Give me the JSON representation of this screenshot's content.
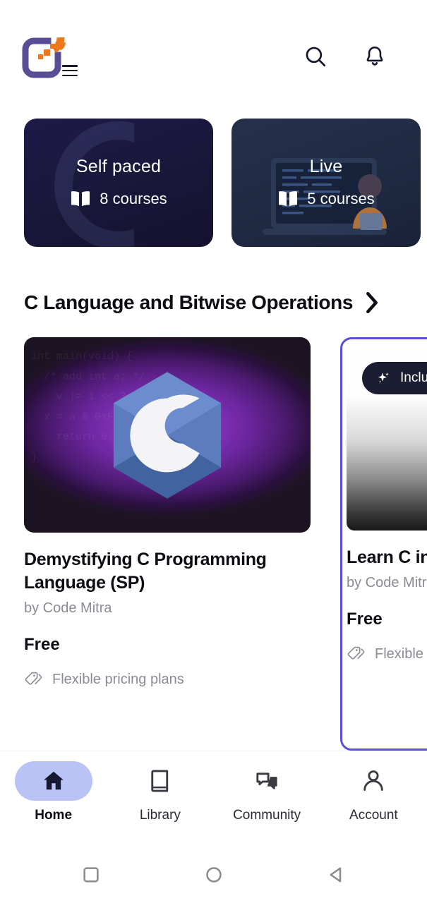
{
  "header": {
    "logo_alt": "Code Mitra logo",
    "menu_label": "Menu",
    "search_label": "Search",
    "notifications_label": "Notifications"
  },
  "categories": [
    {
      "title": "Self paced",
      "count_label": "8 courses",
      "icon": "book-icon"
    },
    {
      "title": "Live",
      "count_label": "5 courses",
      "icon": "book-icon"
    }
  ],
  "section": {
    "title": "C Language and Bitwise Operations",
    "chevron": "chevron-right-icon"
  },
  "courses": [
    {
      "title": "Demystifying C Programming Language (SP)",
      "author": "by Code Mitra",
      "price": "Free",
      "pricing_note": "Flexible pricing plans",
      "badge": null,
      "thumb_type": "c-logo",
      "code_bg": "int main(void) {\n  /* add int a; */\n    v |= 1 << 3;\n  x = a & 0xFF; y |= z;\n    return 0;\n}"
    },
    {
      "title": "Learn C in M",
      "author": "by Code Mitra",
      "price": "Free",
      "pricing_note": "Flexible pr",
      "badge": "Included",
      "thumb_type": "gradient",
      "code_bg": ""
    }
  ],
  "bottom_nav": [
    {
      "label": "Home",
      "icon": "home-icon",
      "active": true
    },
    {
      "label": "Library",
      "icon": "book-closed-icon",
      "active": false
    },
    {
      "label": "Community",
      "icon": "chat-bubbles-icon",
      "active": false
    },
    {
      "label": "Account",
      "icon": "person-icon",
      "active": false
    }
  ],
  "system_bar": [
    {
      "name": "recents-button",
      "icon": "square-icon"
    },
    {
      "name": "home-button",
      "icon": "circle-icon"
    },
    {
      "name": "back-button",
      "icon": "triangle-left-icon"
    }
  ],
  "colors": {
    "brand_purple": "#5a4fd6",
    "brand_orange": "#ec7a1c",
    "nav_active_pill": "#bac3f5",
    "dark_navy": "#1b1e33",
    "muted_text": "#8b8b93"
  }
}
